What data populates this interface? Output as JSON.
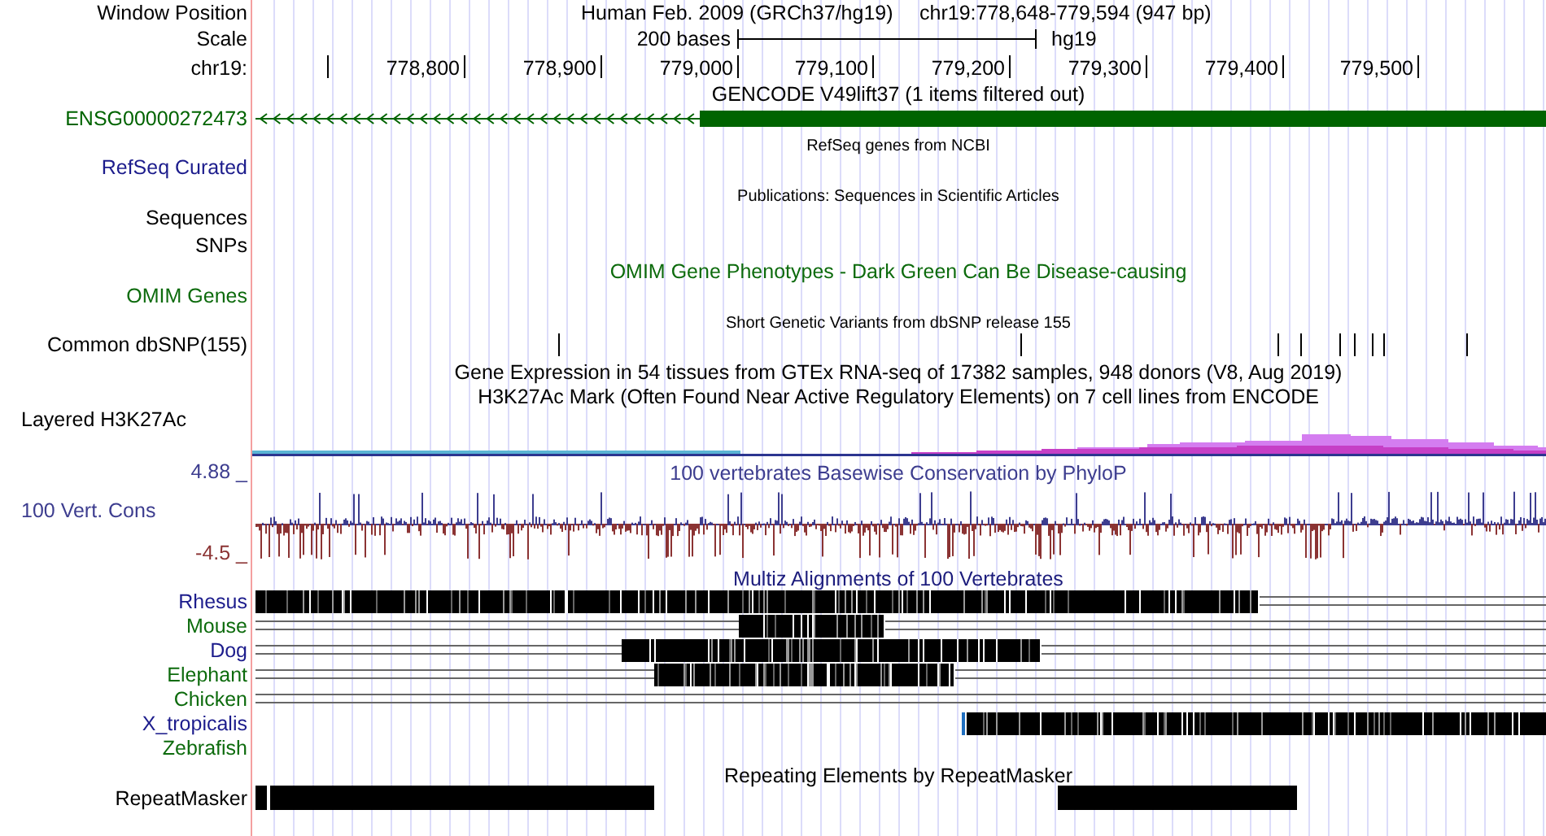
{
  "tracks": [
    {
      "kind": "position",
      "label": "Window Position",
      "title": "Human Feb. 2009 (GRCh37/hg19)",
      "detail": "chr19:778,648-779,594 (947 bp)"
    },
    {
      "kind": "scale",
      "label": "Scale",
      "bar_label": "200 bases",
      "assembly": "hg19"
    },
    {
      "kind": "ruler",
      "label": "chr19:",
      "ticks": [
        "778,800",
        "778,900",
        "779,000",
        "779,100",
        "779,200",
        "779,300",
        "779,400",
        "779,500"
      ]
    },
    {
      "kind": "gene",
      "title": "GENCODE V49lift37 (1 items filtered out)",
      "label": {
        "text": "ENSG00000272473",
        "color": "#006400"
      }
    },
    {
      "kind": "empty",
      "title": "RefSeq genes from NCBI",
      "label": {
        "text": "RefSeq Curated",
        "color": "#1c1c8c"
      }
    },
    {
      "kind": "empty",
      "title": "Publications: Sequences in Scientific Articles",
      "label": "Sequences"
    },
    {
      "kind": "empty",
      "label": "SNPs"
    },
    {
      "kind": "empty",
      "title": {
        "text": "OMIM Gene Phenotypes - Dark Green Can Be Disease-causing",
        "color": "#0d6b0d"
      },
      "label": {
        "text": "OMIM Genes",
        "color": "#0d6b0d"
      }
    },
    {
      "kind": "snp",
      "title": "Short Genetic Variants from dbSNP release 155",
      "label": "Common dbSNP(155)"
    },
    {
      "kind": "empty",
      "title": "Gene Expression in 54 tissues from GTEx RNA-seq of 17382 samples, 948 donors (V8, Aug 2019)"
    },
    {
      "kind": "layered",
      "title": "H3K27Ac Mark (Often Found Near Active Regulatory Elements) on 7 cell lines from ENCODE",
      "label": "Layered H3K27Ac"
    },
    {
      "kind": "wiggle",
      "title": {
        "text": "100 vertebrates Basewise Conservation by PhyloP",
        "color": "#3d3d8f"
      },
      "label": {
        "text": "100 Vert. Cons",
        "color": "#3d3d8f"
      },
      "max": {
        "text": "4.88 _",
        "color": "#3d3d8f"
      },
      "min": {
        "text": "-4.5 _",
        "color": "#8b3333"
      }
    },
    {
      "kind": "multiz",
      "title": {
        "text": "Multiz Alignments of 100 Vertebrates",
        "color": "#1c1c7c"
      },
      "species": [
        {
          "name": "Rhesus",
          "color": "#1c1c8c"
        },
        {
          "name": "Mouse",
          "color": "#0d6b0d"
        },
        {
          "name": "Dog",
          "color": "#1c1c8c"
        },
        {
          "name": "Elephant",
          "color": "#0d6b0d"
        },
        {
          "name": "Chicken",
          "color": "#0d6b0d"
        },
        {
          "name": "X_tropicalis",
          "color": "#1c1c8c"
        },
        {
          "name": "Zebrafish",
          "color": "#0d6b0d"
        }
      ]
    },
    {
      "kind": "repeat",
      "title": "Repeating Elements by RepeatMasker",
      "label": "RepeatMasker"
    }
  ]
}
